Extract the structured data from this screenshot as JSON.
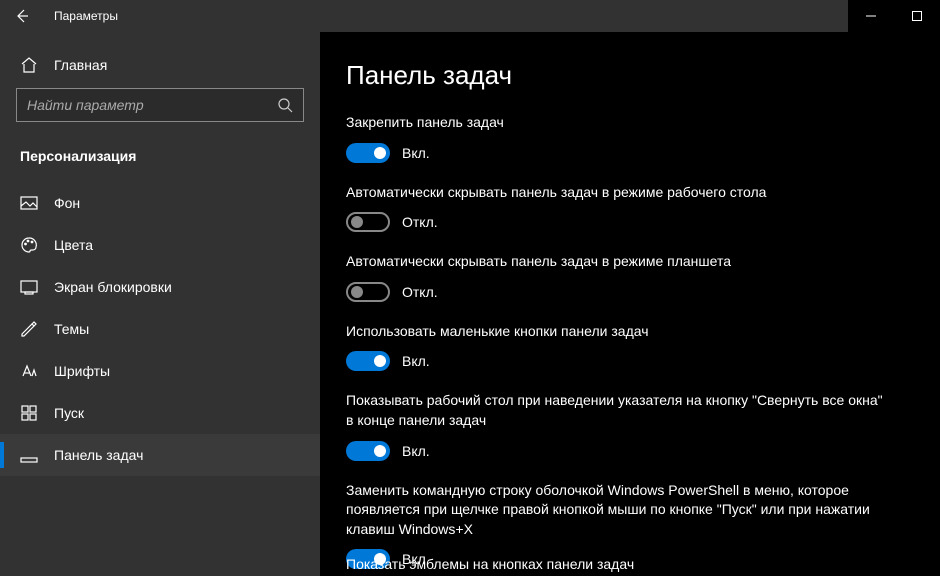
{
  "titlebar": {
    "title": "Параметры"
  },
  "home_label": "Главная",
  "search": {
    "placeholder": "Найти параметр"
  },
  "category": "Персонализация",
  "nav": {
    "items": [
      {
        "label": "Фон"
      },
      {
        "label": "Цвета"
      },
      {
        "label": "Экран блокировки"
      },
      {
        "label": "Темы"
      },
      {
        "label": "Шрифты"
      },
      {
        "label": "Пуск"
      },
      {
        "label": "Панель задач"
      }
    ]
  },
  "page": {
    "title": "Панель задач",
    "settings": [
      {
        "label": "Закрепить панель задач",
        "on": true,
        "state": "Вкл."
      },
      {
        "label": "Автоматически скрывать панель задач в режиме рабочего стола",
        "on": false,
        "state": "Откл."
      },
      {
        "label": "Автоматически скрывать панель задач в режиме планшета",
        "on": false,
        "state": "Откл."
      },
      {
        "label": "Использовать маленькие кнопки панели задач",
        "on": true,
        "state": "Вкл."
      },
      {
        "label": "Показывать рабочий стол при наведении указателя на кнопку \"Свернуть все окна\" в конце панели задач",
        "on": true,
        "state": "Вкл."
      },
      {
        "label": "Заменить командную строку оболочкой Windows PowerShell в меню, которое появляется при щелчке правой кнопкой мыши по кнопке \"Пуск\" или при нажатии клавиш Windows+X",
        "on": true,
        "state": "Вкл."
      }
    ],
    "footer_cut": "Показать эмблемы на кнопках панели задач"
  },
  "colors": {
    "accent": "#0078d7"
  }
}
